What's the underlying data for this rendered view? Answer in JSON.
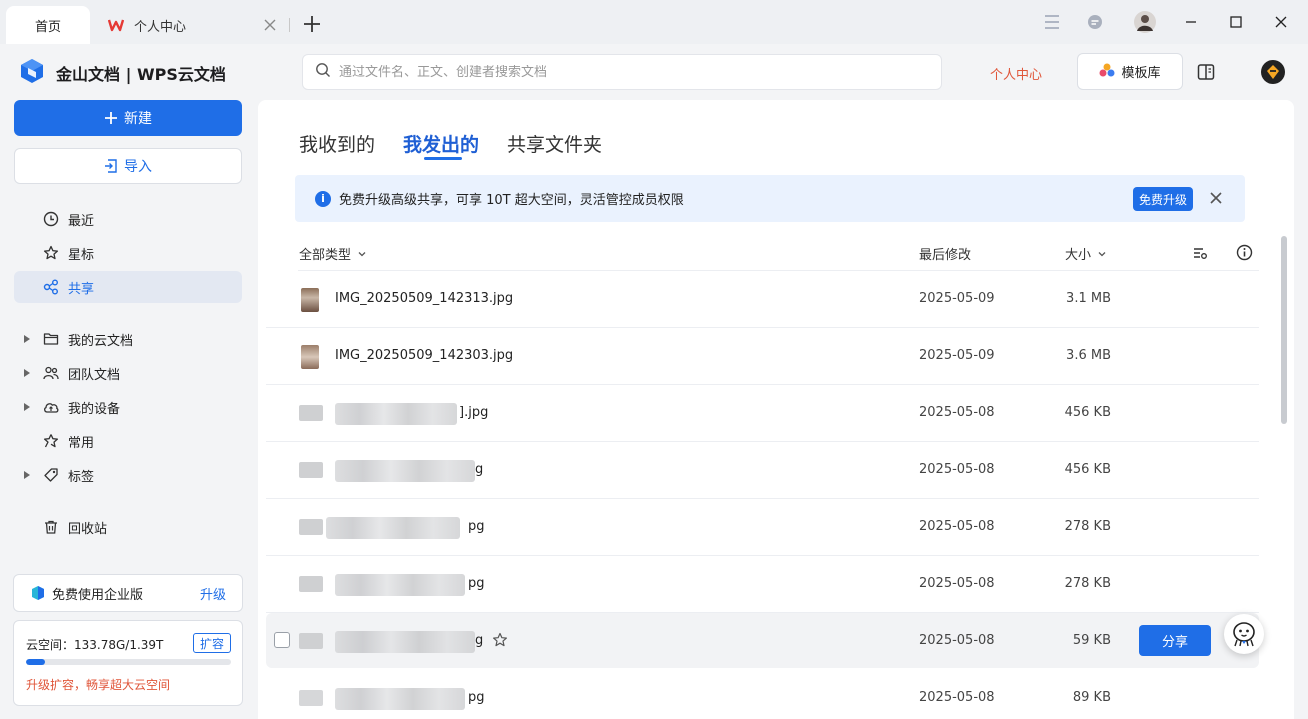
{
  "tabs": {
    "home": "首页",
    "user_center": "个人中心"
  },
  "brand": {
    "name": "金山文档 | WPS云文档"
  },
  "search": {
    "placeholder": "通过文件名、正文、创建者搜索文档"
  },
  "header": {
    "personal_center": "个人中心",
    "template_library": "模板库"
  },
  "sidebar": {
    "new_label": "新建",
    "import_label": "导入",
    "items": [
      {
        "label": "最近",
        "icon": "clock-icon"
      },
      {
        "label": "星标",
        "icon": "star-icon"
      },
      {
        "label": "共享",
        "icon": "share-icon"
      },
      {
        "label": "我的云文档",
        "icon": "folder-icon"
      },
      {
        "label": "团队文档",
        "icon": "team-icon"
      },
      {
        "label": "我的设备",
        "icon": "cloud-device-icon"
      },
      {
        "label": "常用",
        "icon": "pin-icon"
      },
      {
        "label": "标签",
        "icon": "tag-icon"
      },
      {
        "label": "回收站",
        "icon": "trash-icon"
      }
    ],
    "enterprise": {
      "label": "免费使用企业版",
      "upgrade": "升级"
    },
    "cloud": {
      "label": "云空间：133.78G/1.39T",
      "expand": "扩容",
      "tip": "升级扩容，畅享超大云空间",
      "usage_fraction": 0.094
    }
  },
  "main": {
    "subtabs": [
      "我收到的",
      "我发出的",
      "共享文件夹"
    ],
    "active_subtab": "我发出的",
    "notice": {
      "text": "免费升级高级共享，可享 10T 超大空间，灵活管控成员权限",
      "button": "免费升级"
    },
    "columns": {
      "type": "全部类型",
      "modified": "最后修改",
      "size": "大小"
    },
    "files": [
      {
        "name": "IMG_20250509_142313.jpg",
        "suffix": "",
        "date": "2025-05-09",
        "size": "3.1 MB"
      },
      {
        "name": "IMG_20250509_142303.jpg",
        "suffix": "",
        "date": "2025-05-09",
        "size": "3.6 MB"
      },
      {
        "name": "",
        "suffix": "].jpg",
        "date": "2025-05-08",
        "size": "456 KB"
      },
      {
        "name": "",
        "suffix": "g",
        "date": "2025-05-08",
        "size": "456 KB"
      },
      {
        "name": "",
        "suffix": "pg",
        "date": "2025-05-08",
        "size": "278 KB"
      },
      {
        "name": "",
        "suffix": "pg",
        "date": "2025-05-08",
        "size": "278 KB"
      },
      {
        "name": "",
        "suffix": "g",
        "date": "2025-05-08",
        "size": "59 KB"
      },
      {
        "name": "",
        "suffix": "pg",
        "date": "2025-05-08",
        "size": "89 KB"
      }
    ],
    "share_button": "分享"
  },
  "colors": {
    "accent": "#1f6ee7",
    "warning_text": "#e0563a",
    "notice_bg": "#eaf2fe"
  }
}
